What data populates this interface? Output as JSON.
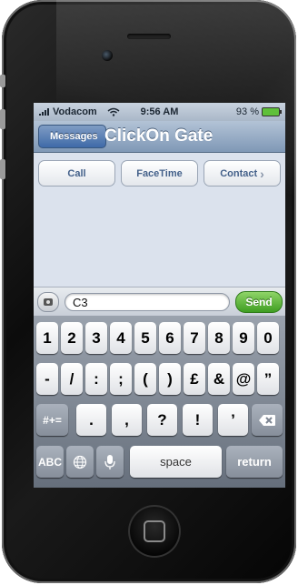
{
  "status_bar": {
    "carrier": "Vodacom",
    "time": "9:56 AM",
    "battery_percent": "93 %"
  },
  "nav": {
    "back_label": "Messages",
    "title": "ClickOn Gate"
  },
  "actions": [
    {
      "label": "Call"
    },
    {
      "label": "FaceTime"
    },
    {
      "label": "Contact",
      "chevron": "›"
    }
  ],
  "compose": {
    "text": "C3",
    "send_label": "Send",
    "camera_icon": "camera-icon"
  },
  "keyboard": {
    "row1": [
      "1",
      "2",
      "3",
      "4",
      "5",
      "6",
      "7",
      "8",
      "9",
      "0"
    ],
    "row2": [
      "-",
      "/",
      ":",
      ";",
      "(",
      ")",
      "£",
      "&",
      "@",
      "”"
    ],
    "row3": {
      "shift": "#+=",
      "keys": [
        ".",
        ",",
        "?",
        "!",
        "’"
      ],
      "delete_icon": "delete-icon"
    },
    "row4": {
      "abc": "ABC",
      "globe_icon": "globe-icon",
      "mic_icon": "mic-icon",
      "space": "space",
      "return": "return"
    }
  },
  "colors": {
    "send": "#3f9e22",
    "nav": "#7f98b6",
    "back": "#3f6aa8"
  }
}
